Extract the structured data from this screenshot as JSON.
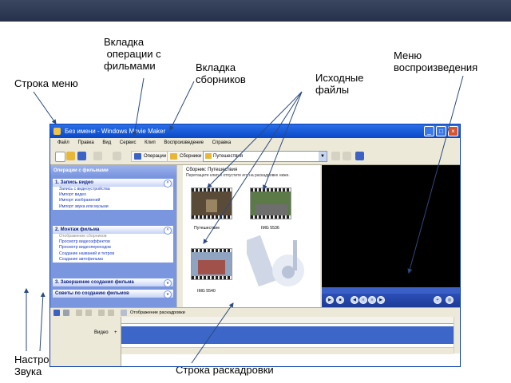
{
  "callouts": {
    "menu_bar": "Строка меню",
    "operations_tab": "Вкладка\n операции с\nфильмами",
    "collections_tab": "Вкладка\nсборников",
    "source_files": "Исходные\nфайлы",
    "playback_menu": "Меню\nвоспроизведения",
    "sound_settings": "Настройка\nЗвука",
    "storyboard_bar": "Строка раскадровки"
  },
  "window": {
    "title": "Без имени - Windows Movie Maker",
    "menu": [
      "Файл",
      "Правка",
      "Вид",
      "Сервис",
      "Клип",
      "Воспроизведение",
      "Справка"
    ],
    "toolbar": {
      "operations_label": "Операции",
      "collections_label": "Сборники",
      "collection_value": "Путешествия"
    }
  },
  "task_pane": {
    "header": "Операции с фильмами",
    "sections": [
      {
        "title": "1. Запись видео",
        "items": [
          "Запись с видеоустройства",
          "Импорт видео",
          "Импорт изображений",
          "Импорт звука или музыки"
        ]
      },
      {
        "title": "2. Монтаж фильма",
        "items": [
          "Отображение сборников",
          "Просмотр видеоэффектов",
          "Просмотр видеопереходов",
          "Создание названий и титров",
          "Создание автофильма"
        ]
      },
      {
        "title": "3. Завершение создания фильма",
        "items": []
      },
      {
        "title": "Советы по созданию фильмов",
        "items": []
      }
    ]
  },
  "collection": {
    "title": "Сборник: Путешествия",
    "subtitle": "Перетащите клип и отпустите его на раскадровке ниже.",
    "clips": [
      "Путешествие",
      "IMG 5536",
      "IMG 5540"
    ]
  },
  "storyboard": {
    "toolbar_label": "Отображение раскадровки",
    "track_label": "Видео"
  },
  "colors": {
    "title_bar": "#0a48c8",
    "task_pane": "#7a96df",
    "monitor": "#000000",
    "video_track": "#3c67c9"
  }
}
